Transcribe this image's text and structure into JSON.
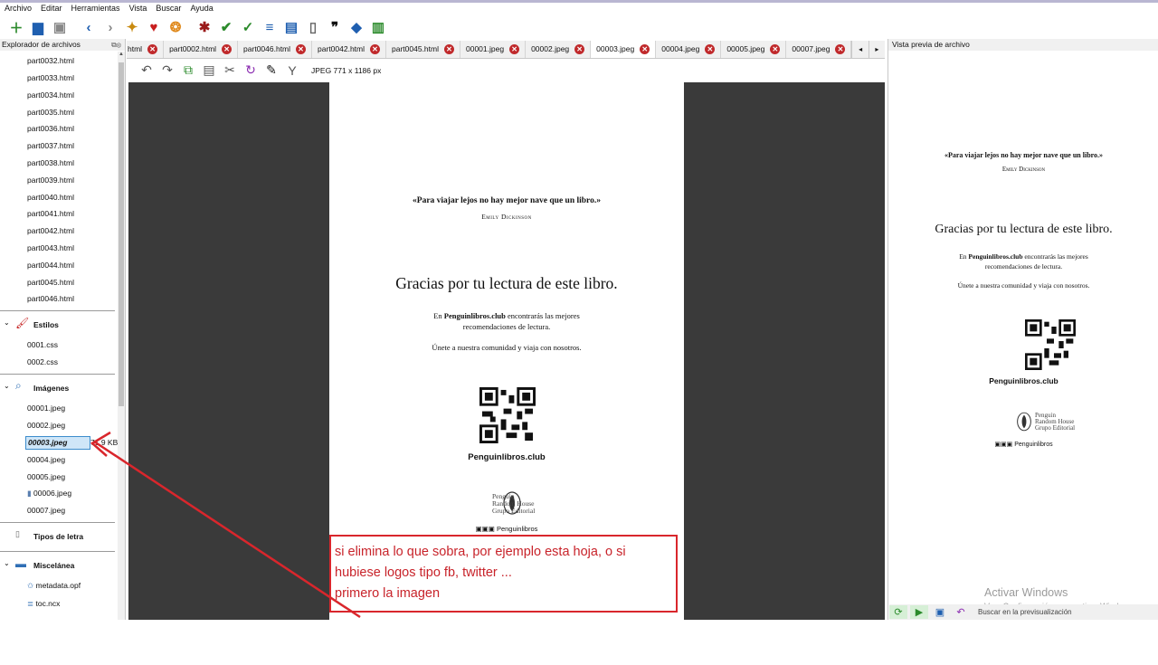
{
  "menu": [
    "Archivo",
    "Editar",
    "Herramientas",
    "Vista",
    "Buscar",
    "Ayuda"
  ],
  "toolbar_icons": [
    "new-file-icon",
    "open-icon",
    "save-icon",
    "back-icon",
    "forward-icon",
    "pin-icon",
    "heart-icon",
    "donate-icon",
    "bug-icon",
    "spellcheck-icon",
    "check-icon",
    "toc-icon",
    "book-icon",
    "font-icon",
    "quote-icon",
    "erase-icon",
    "bars-icon"
  ],
  "explorer": {
    "title": "Explorador de archivos",
    "html_files": [
      "part0032.html",
      "part0033.html",
      "part0034.html",
      "part0035.html",
      "part0036.html",
      "part0037.html",
      "part0038.html",
      "part0039.html",
      "part0040.html",
      "part0041.html",
      "part0042.html",
      "part0043.html",
      "part0044.html",
      "part0045.html",
      "part0046.html"
    ],
    "styles_label": "Estilos",
    "css_files": [
      "0001.css",
      "0002.css"
    ],
    "images_label": "Imágenes",
    "image_files": [
      "00001.jpeg",
      "00002.jpeg",
      "00003.jpeg",
      "00004.jpeg",
      "00005.jpeg",
      "00006.jpeg",
      "00007.jpeg"
    ],
    "selected_size": "71,9 KB",
    "fonts_label": "Tipos de letra",
    "misc_label": "Miscelánea",
    "misc_files": [
      "metadata.opf",
      "toc.ncx"
    ]
  },
  "tabs": [
    {
      "label": "html",
      "active": false
    },
    {
      "label": "part0002.html",
      "active": false
    },
    {
      "label": "part0046.html",
      "active": false
    },
    {
      "label": "part0042.html",
      "active": false
    },
    {
      "label": "part0045.html",
      "active": false
    },
    {
      "label": "00001.jpeg",
      "active": false
    },
    {
      "label": "00002.jpeg",
      "active": false
    },
    {
      "label": "00003.jpeg",
      "active": true
    },
    {
      "label": "00004.jpeg",
      "active": false
    },
    {
      "label": "00005.jpeg",
      "active": false
    },
    {
      "label": "00007.jpeg",
      "active": false
    }
  ],
  "image_info": "JPEG  771 x 1186 px",
  "page": {
    "quote": "«Para viajar lejos no hay mejor nave que un libro.»",
    "author": "Emily Dickinson",
    "thanks": "Gracias por tu lectura de este libro.",
    "promo_pre": "En ",
    "promo_site": "Penguinlibros.club",
    "promo_post": " encontrarás las mejores",
    "promo_line2": "recomendaciones de lectura.",
    "join": "Únete a nuestra comunidad y viaja con nosotros.",
    "site": "Penguinlibros.club",
    "logo_lines": [
      "Penguin",
      "Random House",
      "Grupo Editorial"
    ],
    "social": "Penguinlibros"
  },
  "annotation": "si elimina lo que sobra, por ejemplo esta hoja, o si\nhubiese logos tipo fb, twitter ...\nprimero la imagen",
  "preview": {
    "title": "Vista previa de archivo",
    "search_label": "Buscar en la previsualización"
  },
  "windows": {
    "activate": "Activar Windows",
    "activate_sub": "Ve a Configuración para activar Windows."
  },
  "colors": {
    "annotation_red": "#d9262c",
    "tab_close_red": "#c0292b",
    "canvas_gray": "#3a3a3a",
    "selection_blue": "#cfe6f8"
  }
}
